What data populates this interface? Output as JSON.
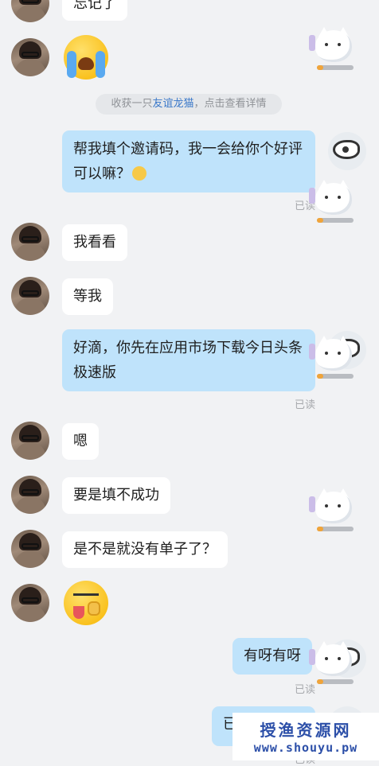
{
  "notice": {
    "prefix": "收获一只",
    "link": "友谊龙猫",
    "suffix": "，点击查看详情"
  },
  "messages": {
    "m0": "忘记了",
    "m2": "帮我填个邀请码，我一会给你个好评可以嘛？",
    "m3": "我看看",
    "m4": "等我",
    "m5": "好滴，你先在应用市场下载今日头条极速版",
    "m6": "嗯",
    "m7": "要是填不成功",
    "m8": "是不是就没有单子了？",
    "m10": "有呀有呀",
    "m11": "已"
  },
  "read_label": "已读",
  "read_label_partial": "已读",
  "watermark": {
    "title": "授渔资源网",
    "url": "www.shouyu.pw"
  },
  "colors": {
    "background": "#f1f2f4",
    "my_bubble": "#bfe3fb",
    "other_bubble": "#ffffff",
    "link": "#3a78c9"
  }
}
